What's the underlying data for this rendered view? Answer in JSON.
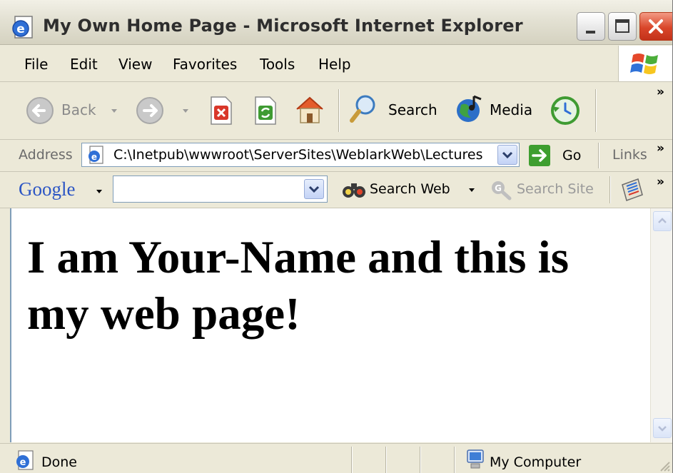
{
  "window": {
    "title": "My Own Home Page - Microsoft Internet Explorer",
    "icon": "ie-page-icon",
    "controls": [
      "minimize-button",
      "maximize-button",
      "close-button"
    ]
  },
  "menubar": {
    "items": [
      {
        "label": "File"
      },
      {
        "label": "Edit"
      },
      {
        "label": "View"
      },
      {
        "label": "Favorites"
      },
      {
        "label": "Tools"
      },
      {
        "label": "Help"
      }
    ],
    "logo_icon": "windows-flag-icon"
  },
  "toolbar": {
    "back_label": "Back",
    "search_label": "Search",
    "media_label": "Media",
    "overflow": "»"
  },
  "addressbar": {
    "label": "Address",
    "value": "C:\\Inetpub\\wwwroot\\ServerSites\\WeblarkWeb\\Lectures",
    "go_label": "Go",
    "links_label": "Links",
    "overflow": "»"
  },
  "googlebar": {
    "brand": "Google",
    "search_placeholder": "",
    "search_web_label": "Search Web",
    "search_site_label": "Search Site",
    "overflow": "»"
  },
  "page": {
    "heading": "I am Your-Name and this is my web page!"
  },
  "statusbar": {
    "status": "Done",
    "zone": "My Computer"
  },
  "colors": {
    "chrome": "#ECE9D8",
    "close_red": "#D9462A",
    "field_border": "#7F9DB9",
    "go_green": "#3E9E2F"
  }
}
